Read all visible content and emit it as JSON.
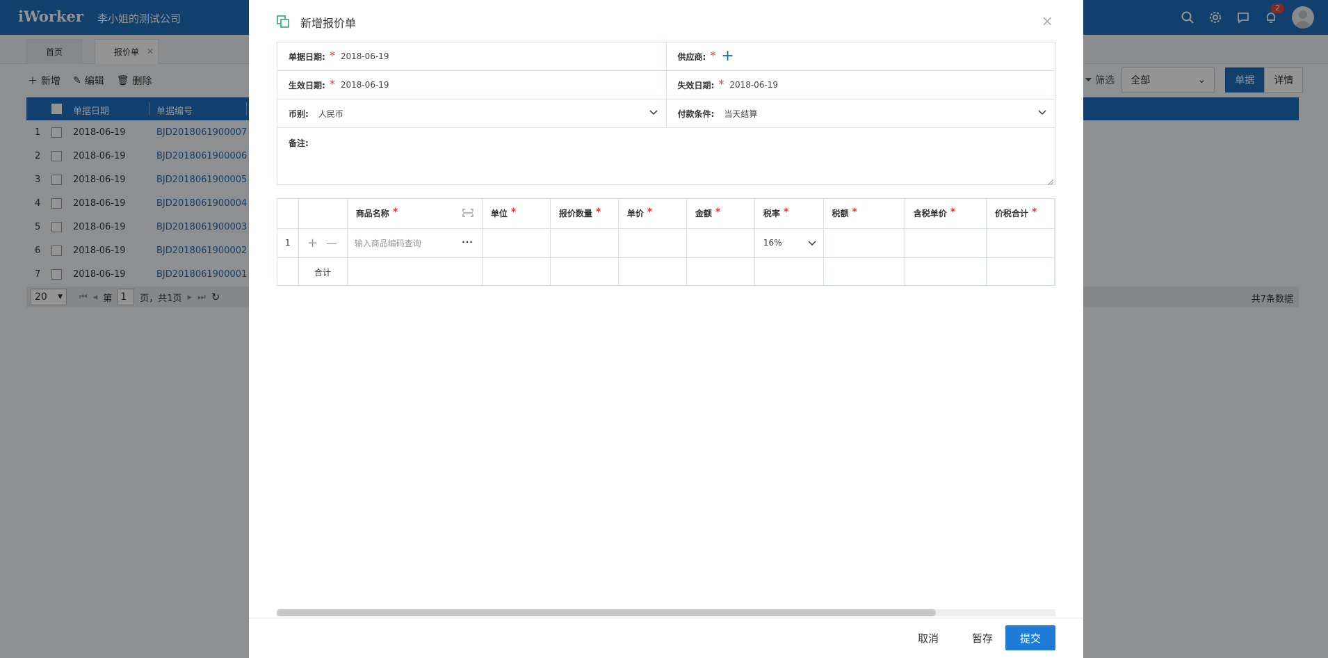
{
  "app": {
    "logo": "iWorker",
    "company": "李小姐的测试公司",
    "notification_count": "2"
  },
  "tabs": [
    {
      "label": "首页"
    },
    {
      "label": "报价单"
    }
  ],
  "toolbar": {
    "add_label": "新增",
    "edit_label": "编辑",
    "delete_label": "删除",
    "filter_label": "筛选",
    "scope_select": "全部",
    "view_bill": "单据",
    "view_detail": "详情"
  },
  "list": {
    "columns": [
      "单据日期",
      "单据编号"
    ],
    "rows": [
      {
        "num": "1",
        "date": "2018-06-19",
        "code": "BJD2018061900007"
      },
      {
        "num": "2",
        "date": "2018-06-19",
        "code": "BJD2018061900006"
      },
      {
        "num": "3",
        "date": "2018-06-19",
        "code": "BJD2018061900005"
      },
      {
        "num": "4",
        "date": "2018-06-19",
        "code": "BJD2018061900004"
      },
      {
        "num": "5",
        "date": "2018-06-19",
        "code": "BJD2018061900003"
      },
      {
        "num": "6",
        "date": "2018-06-19",
        "code": "BJD2018061900002"
      },
      {
        "num": "7",
        "date": "2018-06-19",
        "code": "BJD2018061900001"
      }
    ],
    "pager": {
      "page_size": "20",
      "page_prefix": "第",
      "page_value": "1",
      "page_suffix": "页，共1页",
      "total": "共7条数据"
    }
  },
  "modal": {
    "title": "新增报价单",
    "form": {
      "bill_date_label": "单据日期:",
      "bill_date_value": "2018-06-19",
      "supplier_label": "供应商:",
      "effective_label": "生效日期:",
      "effective_value": "2018-06-19",
      "expire_label": "失效日期:",
      "expire_value": "2018-06-19",
      "currency_label": "币别:",
      "currency_value": "人民币",
      "payment_label": "付款条件:",
      "payment_value": "当天结算",
      "remark_label": "备注:"
    },
    "grid": {
      "columns": [
        "商品名称",
        "单位",
        "报价数量",
        "单价",
        "金额",
        "税率",
        "税额",
        "含税单价",
        "价税合计"
      ],
      "row_num": "1",
      "product_placeholder": "输入商品编码查询",
      "tax_rate": "16%",
      "total_label": "合计"
    },
    "buttons": {
      "cancel": "取消",
      "save_draft": "暂存",
      "submit": "提交"
    }
  }
}
